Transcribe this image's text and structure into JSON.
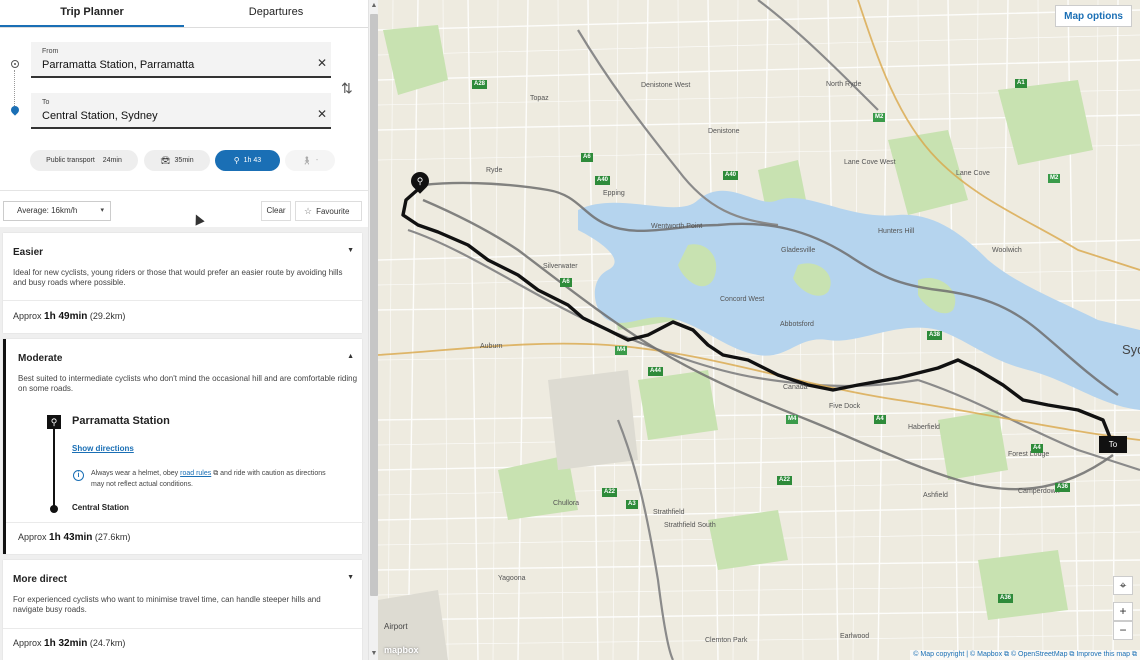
{
  "tabs": [
    {
      "label": "Trip Planner"
    },
    {
      "label": "Departures"
    }
  ],
  "from": {
    "label": "From",
    "value": "Parramatta Station, Parramatta"
  },
  "to": {
    "label": "To",
    "value": "Central Station, Sydney"
  },
  "modes": [
    {
      "label": "Public transport",
      "time": "24min",
      "icon": "bus-icon"
    },
    {
      "label": "",
      "time": "35min",
      "icon": "car-icon"
    },
    {
      "label": "",
      "time": "1h 43",
      "icon": "bicycle-icon"
    },
    {
      "label": "",
      "time": "-",
      "icon": "walk-icon"
    }
  ],
  "filters": {
    "average": "Average:  16km/h",
    "clear": "Clear",
    "favourite": "Favourite"
  },
  "routes": [
    {
      "title": "Easier",
      "desc": "Ideal for new cyclists, young riders or those that would prefer an easier route by avoiding hills and busy roads where possible.",
      "approx": "Approx",
      "duration": "1h 49min",
      "distance": "(29.2km)"
    },
    {
      "title": "Moderate",
      "desc": "Best suited to intermediate cyclists who don't mind the occasional hill and are comfortable riding on some roads.",
      "approx": "Approx",
      "duration": "1h 43min",
      "distance": "(27.6km)",
      "start": "Parramatta Station",
      "show_directions": "Show directions",
      "note_before": "Always wear a helmet, obey",
      "note_link": "road rules",
      "note_after": "and ride with caution as directions may not reflect actual conditions.",
      "end": "Central Station"
    },
    {
      "title": "More direct",
      "desc": "For experienced cyclists who want to minimise travel time, can handle steeper hills and navigate busy roads.",
      "approx": "Approx",
      "duration": "1h 32min",
      "distance": "(24.7km)"
    }
  ],
  "map": {
    "options": "Map options",
    "dest_label": "To",
    "logo": "mapbox",
    "attribution": "© Map copyright | © Mapbox ⧉ © OpenStreetMap ⧉ Improve this map ⧉",
    "suburbs": [
      "Ryde",
      "Denistone West",
      "Topaz",
      "Denistone",
      "North Ryde",
      "Epping",
      "Lane Cove",
      "Lane Cove West",
      "Gladesville",
      "Hunters Hill",
      "Woolwich",
      "Wentworth Point",
      "Silverwater",
      "Concord West",
      "Abbotsford",
      "Auburn",
      "Canada",
      "Five Dock",
      "Haberfield",
      "Forest Lodge",
      "Camperdown",
      "Strathfield",
      "Strathfield South",
      "Chullora",
      "Yagoona",
      "Ashfield",
      "Clemton Park",
      "Earlwood",
      "Airport",
      "Syd"
    ],
    "shields": [
      "A28",
      "A6",
      "A40",
      "A1",
      "M2",
      "A38",
      "M4",
      "A44",
      "A4",
      "A22",
      "A3",
      "M4",
      "A22",
      "A36",
      "A4",
      "A40",
      "A6",
      "M2",
      "A36"
    ],
    "controls": [
      "locate-icon",
      "+",
      "−"
    ]
  },
  "colors": {
    "accent": "#1a6fb5",
    "route": "#111111",
    "water": "#b5d4ee",
    "park": "#c8e2b1"
  }
}
